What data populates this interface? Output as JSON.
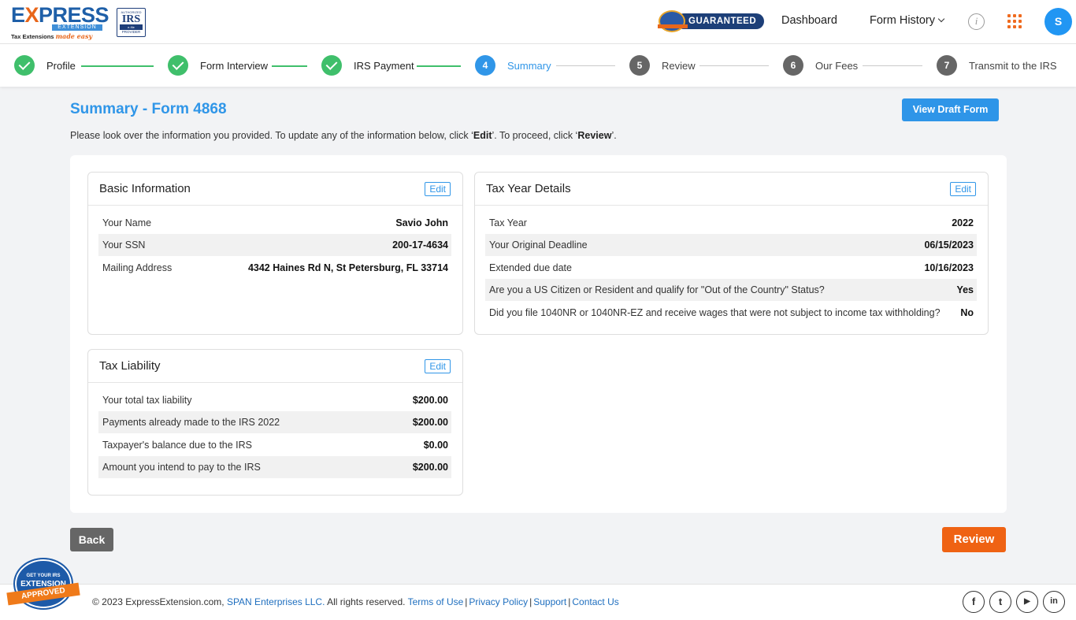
{
  "header": {
    "logo_brand_pre": "E",
    "logo_brand_x": "X",
    "logo_brand_post": "PRESS",
    "logo_sub": "EXTENSION",
    "logo_tagline": "Tax Extensions",
    "logo_tagline_script": "made easy",
    "irs_line1": "AUTHORIZED",
    "irs_line2": "IRS",
    "irs_line3": "e-file",
    "irs_line4": "PROVIDER",
    "guaranteed": "GUARANTEED",
    "nav_dashboard": "Dashboard",
    "nav_form_history": "Form History",
    "info_glyph": "i",
    "avatar_initial": "S"
  },
  "stepper": [
    {
      "num": "1",
      "label": "Profile",
      "status": "done"
    },
    {
      "num": "2",
      "label": "Form Interview",
      "status": "done"
    },
    {
      "num": "3",
      "label": "IRS Payment",
      "status": "done"
    },
    {
      "num": "4",
      "label": "Summary",
      "status": "active"
    },
    {
      "num": "5",
      "label": "Review",
      "status": "todo"
    },
    {
      "num": "6",
      "label": "Our Fees",
      "status": "todo"
    },
    {
      "num": "7",
      "label": "Transmit to the IRS",
      "status": "todo"
    }
  ],
  "main": {
    "title": "Summary - Form 4868",
    "view_draft": "View Draft Form",
    "instructions_pre": "Please look over the information you provided. To update any of the information below, click ‘",
    "instructions_edit": "Edit",
    "instructions_mid": "’. To proceed, click ‘",
    "instructions_review": "Review",
    "instructions_post": "’."
  },
  "basic_info": {
    "title": "Basic Information",
    "edit": "Edit",
    "rows": [
      {
        "label": "Your Name",
        "value": "Savio John"
      },
      {
        "label": "Your SSN",
        "value": "200-17-4634"
      },
      {
        "label": "Mailing Address",
        "value": "4342 Haines Rd N, St Petersburg, FL 33714"
      }
    ]
  },
  "tax_year": {
    "title": "Tax Year Details",
    "edit": "Edit",
    "rows": [
      {
        "label": "Tax Year",
        "value": "2022"
      },
      {
        "label": "Your Original Deadline",
        "value": "06/15/2023"
      },
      {
        "label": "Extended due date",
        "value": "10/16/2023"
      },
      {
        "label": "Are you a US Citizen or Resident and qualify for \"Out of the Country\" Status?",
        "value": "Yes"
      },
      {
        "label": "Did you file 1040NR or 1040NR-EZ and receive wages that were not subject to income tax withholding?",
        "value": "No"
      }
    ]
  },
  "tax_liability": {
    "title": "Tax Liability",
    "edit": "Edit",
    "rows": [
      {
        "label": "Your total tax liability",
        "value": "$200.00"
      },
      {
        "label": "Payments already made to the IRS 2022",
        "value": "$200.00"
      },
      {
        "label": "Taxpayer's balance due to the IRS",
        "value": "$0.00"
      },
      {
        "label": "Amount you intend to pay to the IRS",
        "value": "$200.00"
      }
    ]
  },
  "actions": {
    "back": "Back",
    "review": "Review"
  },
  "footer": {
    "copyright": "© 2023 ExpressExtension.com,",
    "company": "SPAN Enterprises LLC.",
    "rights": "All rights reserved.",
    "terms": "Terms of Use",
    "privacy": "Privacy Policy",
    "support": "Support",
    "contact": "Contact Us",
    "sep": "|",
    "social": [
      "f",
      "t",
      "▶",
      "in"
    ],
    "seal_line1": "GET YOUR IRS",
    "seal_line2": "EXTENSION",
    "seal_line3": "APPROVED"
  },
  "colors": {
    "accent": "#3096e8",
    "success": "#3fbf6b",
    "review_button": "#ef6213",
    "back_button": "#666666"
  }
}
